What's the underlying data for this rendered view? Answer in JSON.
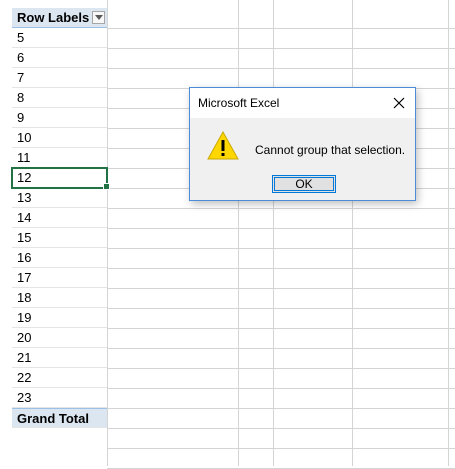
{
  "pivot": {
    "header_label": "Row Labels",
    "rows": [
      "5",
      "6",
      "7",
      "8",
      "9",
      "10",
      "11",
      "12",
      "13",
      "14",
      "15",
      "16",
      "17",
      "18",
      "19",
      "20",
      "21",
      "22",
      "23"
    ],
    "selected_row": "12",
    "total_label": "Grand Total"
  },
  "dialog": {
    "title": "Microsoft Excel",
    "message": "Cannot group that selection.",
    "ok_label": "OK",
    "icon": "warning-icon",
    "close_icon": "close-icon"
  },
  "colors": {
    "pivot_header_fill": "#dce6f1",
    "selection_border": "#217346",
    "dialog_border": "#4b8cd6",
    "warning_fill": "#ffd700"
  }
}
